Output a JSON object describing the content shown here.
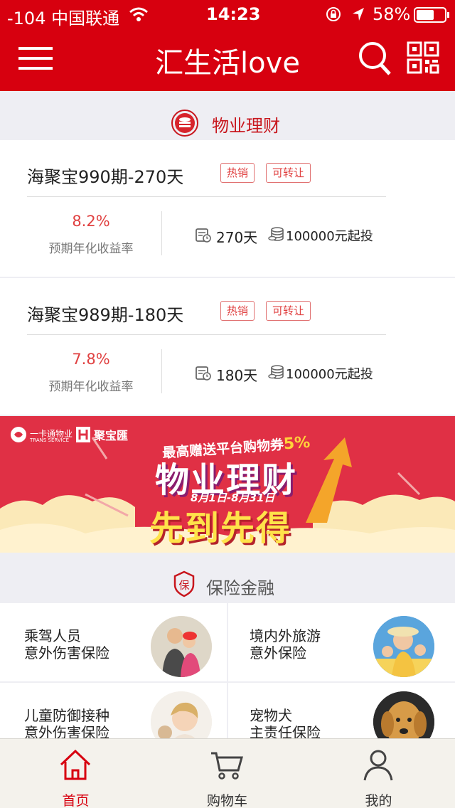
{
  "status_bar": {
    "carrier": "-104 中国联通",
    "time": "14:23",
    "battery": "58%"
  },
  "nav": {
    "title": "汇生活love"
  },
  "finance_section": {
    "title": "物业理财"
  },
  "products": [
    {
      "name": "海聚宝990期-270天",
      "tags": [
        "热销",
        "可转让"
      ],
      "rate": "8.2%",
      "rate_label": "预期年化收益率",
      "term": "270天",
      "min_invest": "100000元起投"
    },
    {
      "name": "海聚宝989期-180天",
      "tags": [
        "热销",
        "可转让"
      ],
      "rate": "7.8%",
      "rate_label": "预期年化收益率",
      "term": "180天",
      "min_invest": "100000元起投"
    }
  ],
  "banner": {
    "brand1": "一卡通物业",
    "brand1_sub": "TRANS SERVICE",
    "brand2": "聚宝匯",
    "promo": "最高赠送平台购物券",
    "promo_pct": "5%",
    "headline": "物业理财",
    "dates": "8月1日-8月31日",
    "slogan": "先到先得"
  },
  "insurance_section": {
    "title": "保险金融"
  },
  "insurance": [
    {
      "line1": "乘驾人员",
      "line2": "意外伤害保险"
    },
    {
      "line1": "境内外旅游",
      "line2": "意外保险"
    },
    {
      "line1": "儿童防御接种",
      "line2": "意外伤害保险"
    },
    {
      "line1": "宠物犬",
      "line2": "主责任保险"
    }
  ],
  "tabbar": {
    "home": "首页",
    "cart": "购物车",
    "mine": "我的"
  },
  "colors": {
    "brand_red": "#d7000f",
    "accent_red": "#e04040"
  }
}
